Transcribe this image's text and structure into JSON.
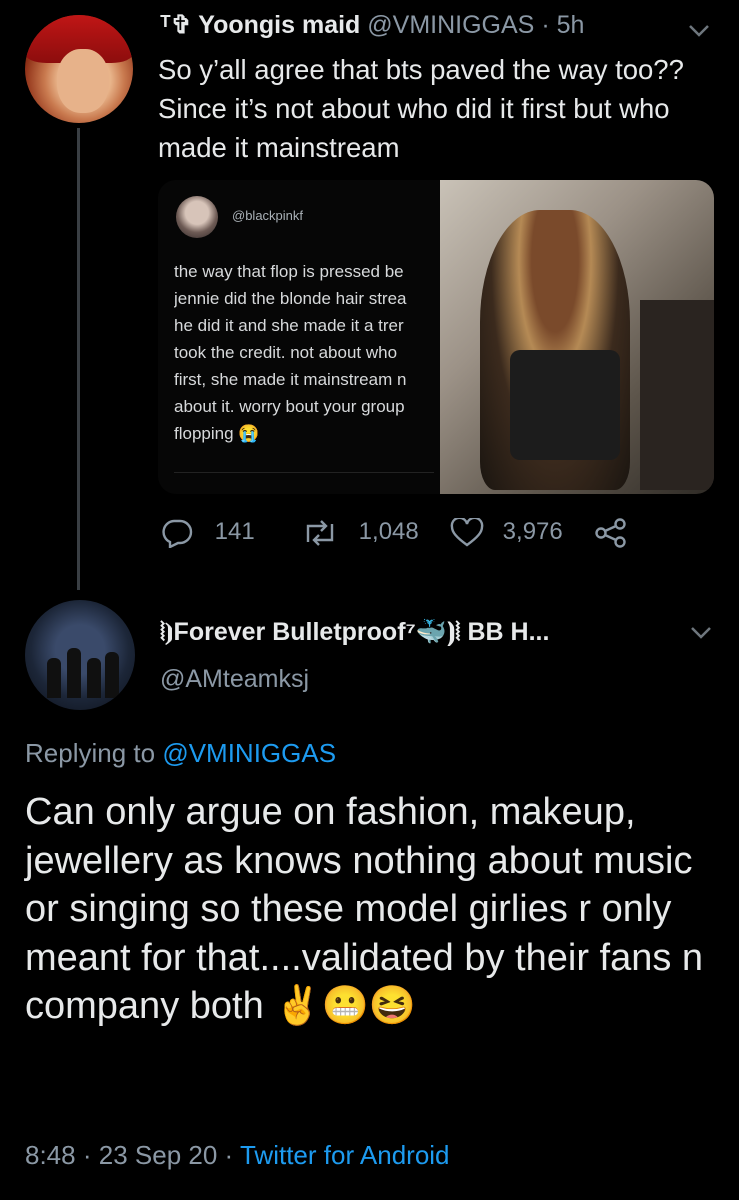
{
  "tweet": {
    "author_name": "ᵀ✞ Yoongis maid",
    "handle": "@VMINIGGAS",
    "time": "5h",
    "text": "So y’all agree that bts paved the way too?? Since it’s not about who did it first but who made it mainstream",
    "quoted_image": {
      "handle": "@blackpinkf",
      "text": "the way that flop is pressed be\njennie did the blonde hair strea\nhe did it and she made it a trer\ntook the credit. not about who \nfirst, she made it mainstream n\nabout it. worry bout your group\nflopping 😭"
    },
    "replies": "141",
    "retweets": "1,048",
    "likes": "3,976"
  },
  "reply": {
    "author_name": "⦚⦘Forever Bulletproof⁷🐳⦘⦚ BB H...",
    "handle": "@AMteamksj",
    "replying_to_label": "Replying to",
    "replying_to_handle": "@VMINIGGAS",
    "text": "Can only argue on fashion, makeup, jewellery as knows nothing about music or singing so these model girlies r only meant for that....validated by their fans n company both ✌️😬😆",
    "time": "8:48",
    "date": "23 Sep 20",
    "source": "Twitter for Android"
  },
  "colors": {
    "background": "#000000",
    "text": "#e7e9ea",
    "secondary": "#8b98a5",
    "link": "#1d9bf0"
  }
}
